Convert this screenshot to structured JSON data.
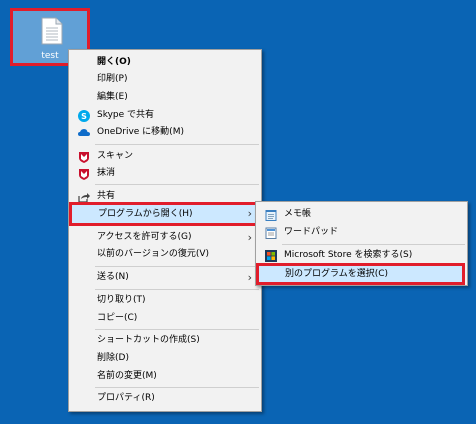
{
  "desktop": {
    "icon_label": "test",
    "colors": {
      "background": "#0a64b4",
      "highlight": "#e11d2b"
    }
  },
  "context_menu": {
    "open": "開く(O)",
    "print": "印刷(P)",
    "edit": "編集(E)",
    "skype_share": "Skype で共有",
    "onedrive_move": "OneDrive に移動(M)",
    "scan": "スキャン",
    "erase": "抹消",
    "share": "共有",
    "open_with": "プログラムから開く(H)",
    "give_access": "アクセスを許可する(G)",
    "restore_versions": "以前のバージョンの復元(V)",
    "send_to": "送る(N)",
    "cut": "切り取り(T)",
    "copy": "コピー(C)",
    "create_shortcut": "ショートカットの作成(S)",
    "delete": "削除(D)",
    "rename": "名前の変更(M)",
    "properties": "プロパティ(R)"
  },
  "submenu": {
    "notepad": "メモ帳",
    "wordpad": "ワードパッド",
    "search_store": "Microsoft Store を検索する(S)",
    "choose_other": "別のプログラムを選択(C)"
  }
}
